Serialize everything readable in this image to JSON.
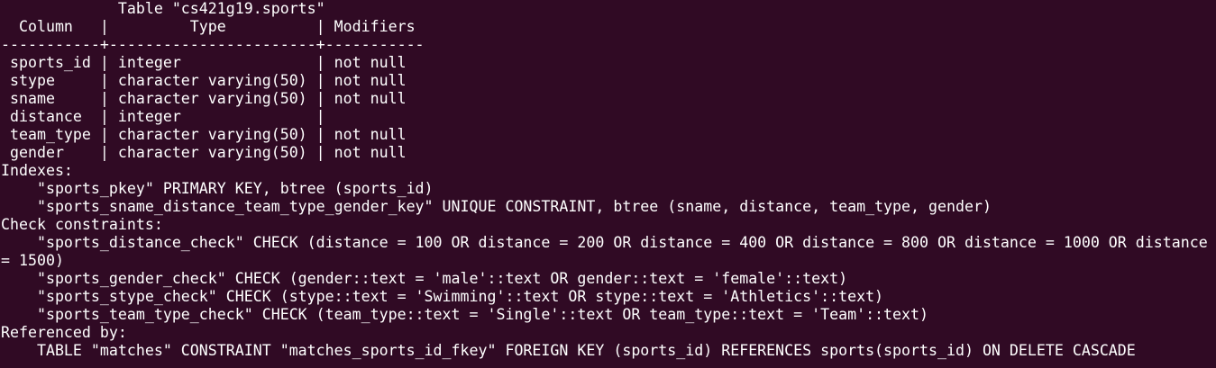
{
  "window": {
    "colors": {
      "background": "#300a24",
      "foreground": "#ffffff"
    }
  },
  "terminal": {
    "table_title": "             Table \"cs421g19.sports\"",
    "header_row": "  Column   |         Type          | Modifiers",
    "separator": "-----------+-----------------------+-----------",
    "columns": [
      " sports_id | integer               | not null",
      " stype     | character varying(50) | not null",
      " sname     | character varying(50) | not null",
      " distance  | integer               |",
      " team_type | character varying(50) | not null",
      " gender    | character varying(50) | not null"
    ],
    "indexes_heading": "Indexes:",
    "indexes": [
      "    \"sports_pkey\" PRIMARY KEY, btree (sports_id)",
      "    \"sports_sname_distance_team_type_gender_key\" UNIQUE CONSTRAINT, btree (sname, distance, team_type, gender)"
    ],
    "checks_heading": "Check constraints:",
    "checks": [
      "    \"sports_distance_check\" CHECK (distance = 100 OR distance = 200 OR distance = 400 OR distance = 800 OR distance = 1000 OR distance",
      "= 1500)",
      "    \"sports_gender_check\" CHECK (gender::text = 'male'::text OR gender::text = 'female'::text)",
      "    \"sports_stype_check\" CHECK (stype::text = 'Swimming'::text OR stype::text = 'Athletics'::text)",
      "    \"sports_team_type_check\" CHECK (team_type::text = 'Single'::text OR team_type::text = 'Team'::text)"
    ],
    "references_heading": "Referenced by:",
    "references": [
      "    TABLE \"matches\" CONSTRAINT \"matches_sports_id_fkey\" FOREIGN KEY (sports_id) REFERENCES sports(sports_id) ON DELETE CASCADE"
    ]
  }
}
